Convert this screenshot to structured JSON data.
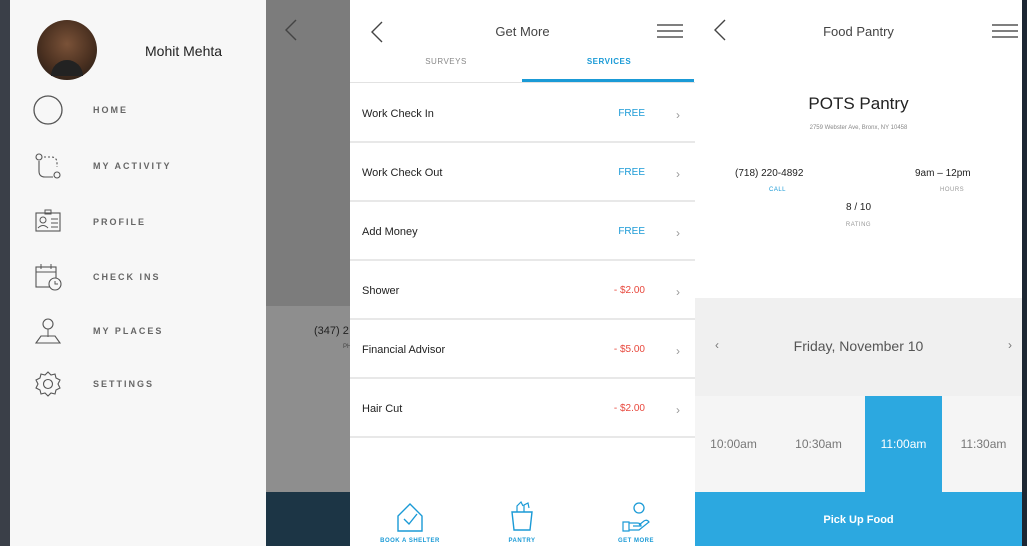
{
  "menu": {
    "user_name": "Mohit Mehta",
    "items": [
      {
        "label": "HOME",
        "icon": "circle-icon"
      },
      {
        "label": "MY ACTIVITY",
        "icon": "route-icon"
      },
      {
        "label": "PROFILE",
        "icon": "id-card-icon"
      },
      {
        "label": "CHECK INS",
        "icon": "calendar-clock-icon"
      },
      {
        "label": "MY PLACES",
        "icon": "map-pin-icon"
      },
      {
        "label": "SETTINGS",
        "icon": "gear-icon"
      }
    ]
  },
  "background_screen": {
    "phone_fragment": "(347) 2",
    "sub_fragment": "PH"
  },
  "get_more": {
    "title": "Get More",
    "tabs": [
      {
        "label": "SURVEYS",
        "active": false
      },
      {
        "label": "SERVICES",
        "active": true
      }
    ],
    "services": [
      {
        "name": "Work Check In",
        "price": "FREE",
        "kind": "free"
      },
      {
        "name": "Work Check Out",
        "price": "FREE",
        "kind": "free"
      },
      {
        "name": "Add Money",
        "price": "FREE",
        "kind": "free"
      },
      {
        "name": "Shower",
        "price": "- $2.00",
        "kind": "cost"
      },
      {
        "name": "Financial Advisor",
        "price": "- $5.00",
        "kind": "cost"
      },
      {
        "name": "Hair Cut",
        "price": "- $2.00",
        "kind": "cost"
      }
    ],
    "bottom_nav": [
      {
        "label": "BOOK A SHELTER",
        "icon": "house-check-icon"
      },
      {
        "label": "PANTRY",
        "icon": "grocery-bag-icon"
      },
      {
        "label": "GET MORE",
        "icon": "hand-coin-icon"
      }
    ]
  },
  "pantry": {
    "title": "Food Pantry",
    "name": "POTS Pantry",
    "address": "2759 Webster Ave, Bronx, NY 10458",
    "phone": "(718) 220-4892",
    "call_label": "CALL",
    "hours": "9am – 12pm",
    "hours_label": "HOURS",
    "rating": "8 / 10",
    "rating_label": "RATING",
    "date": "Friday, November 10",
    "time_slots": [
      {
        "label": "10:00am",
        "selected": false
      },
      {
        "label": "10:30am",
        "selected": false
      },
      {
        "label": "11:00am",
        "selected": true
      },
      {
        "label": "11:30am",
        "selected": false
      }
    ],
    "action_label": "Pick Up Food"
  },
  "colors": {
    "accent": "#2ca8e0",
    "free": "#1a9ad6",
    "cost": "#e8483d"
  }
}
